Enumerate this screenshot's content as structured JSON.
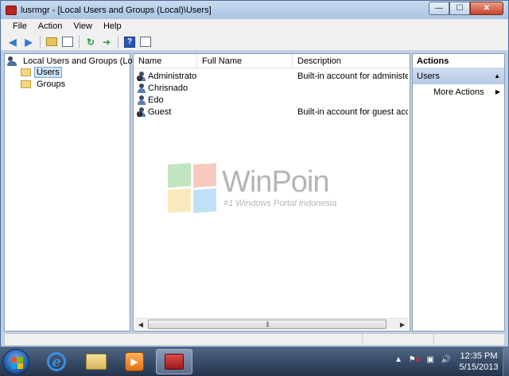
{
  "window": {
    "title": "lusrmgr - [Local Users and Groups (Local)\\Users]",
    "controls": {
      "minimize": "—",
      "maximize": "☐",
      "close": "✕"
    }
  },
  "menu": [
    "File",
    "Action",
    "View",
    "Help"
  ],
  "toolbar_icons": [
    "back-arrow-icon",
    "forward-arrow-icon",
    "up-folder-icon",
    "show-hide-tree-icon",
    "refresh-icon",
    "export-list-icon",
    "help-icon",
    "show-hide-action-pane-icon"
  ],
  "tree": {
    "root": "Local Users and Groups (Local)",
    "children": [
      {
        "label": "Users",
        "selected": true
      },
      {
        "label": "Groups",
        "selected": false
      }
    ]
  },
  "list": {
    "columns": [
      "Name",
      "Full Name",
      "Description"
    ],
    "rows": [
      {
        "name": "Administrator",
        "full_name": "",
        "description": "Built-in account for administering",
        "disabled": true
      },
      {
        "name": "Chrisnado",
        "full_name": "",
        "description": "",
        "disabled": false
      },
      {
        "name": "Edo",
        "full_name": "",
        "description": "",
        "disabled": false
      },
      {
        "name": "Guest",
        "full_name": "",
        "description": "Built-in account for guest access t",
        "disabled": true
      }
    ],
    "scroll_left": "◀",
    "scroll_right": "▶",
    "scroll_grip": "|||"
  },
  "actions": {
    "header": "Actions",
    "group": "Users",
    "group_caret": "▲",
    "items": [
      {
        "label": "More Actions",
        "caret": "▶"
      }
    ]
  },
  "watermark": {
    "title": "WinPoin",
    "subtitle": "#1 Windows Portal Indonesia"
  },
  "taskbar": {
    "apps": [
      "internet-explorer-icon",
      "windows-explorer-icon",
      "media-player-icon",
      "toolbox-icon"
    ],
    "active_app": "toolbox-icon",
    "tray": {
      "expand": "▲",
      "volume": "🔊"
    },
    "clock": {
      "time": "12:35 PM",
      "date": "5/15/2013"
    }
  },
  "colors": {
    "window_frame": "#bcd0e8",
    "selection": "#cce4f7",
    "taskbar_top": "#4e6584",
    "taskbar_bottom": "#24344c"
  }
}
